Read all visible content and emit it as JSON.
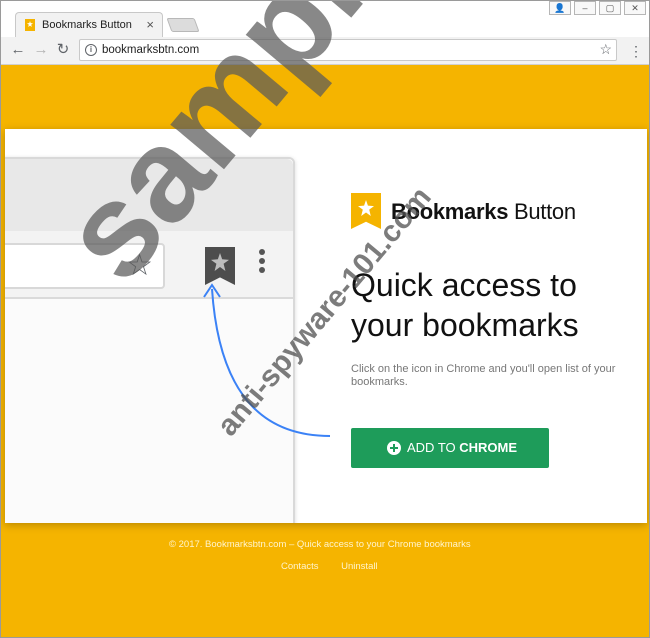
{
  "browser": {
    "tab_title": "Bookmarks Button",
    "tab_close": "×",
    "url": "bookmarksbtn.com",
    "window_controls": [
      "👤",
      "▢",
      "✕"
    ],
    "nav": {
      "back": "←",
      "forward": "→",
      "reload": "↻"
    },
    "menu": "⋮"
  },
  "icons": {
    "tab_favicon": "bookmark-star-icon",
    "info": "info-icon",
    "bookmark_star": "star-outline-icon"
  },
  "hero": {
    "brand_bold": "Bookmarks",
    "brand_rest": " Button",
    "headline": "Quick access to your bookmarks",
    "subtitle": "Click on the icon in Chrome and you'll open list of your bookmarks.",
    "cta_prefix": "ADD TO ",
    "cta_bold": "CHROME"
  },
  "footer": {
    "copyright": "© 2017. Bookmarksbtn.com – Quick access to your Chrome bookmarks",
    "links": [
      "Contacts",
      "Uninstall"
    ]
  },
  "watermark": {
    "big": "sample",
    "small": "anti-spyware-101.com"
  },
  "colors": {
    "brand_yellow": "#f5b400",
    "cta_green": "#1e9c5a",
    "arrow_blue": "#3b82f6"
  }
}
